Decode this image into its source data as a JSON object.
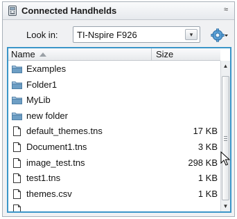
{
  "panel": {
    "title": "Connected Handhelds",
    "collapse_glyph": "≈",
    "icons": {
      "title": "handheld-icon",
      "collapse": "collapse-icon",
      "gear": "gear-icon"
    }
  },
  "lookin": {
    "label": "Look in:",
    "value": "TI-Nspire F926",
    "dropdown_glyph": "▾"
  },
  "filelist": {
    "columns": {
      "name": "Name",
      "size": "Size"
    },
    "sort": "ascending",
    "items": [
      {
        "name": "Examples",
        "size": "",
        "type": "folder"
      },
      {
        "name": "Folder1",
        "size": "",
        "type": "folder"
      },
      {
        "name": "MyLib",
        "size": "",
        "type": "folder"
      },
      {
        "name": "new folder",
        "size": "",
        "type": "folder"
      },
      {
        "name": "default_themes.tns",
        "size": "17 KB",
        "type": "file"
      },
      {
        "name": "Document1.tns",
        "size": "3 KB",
        "type": "file"
      },
      {
        "name": "image_test.tns",
        "size": "298 KB",
        "type": "file"
      },
      {
        "name": "test1.tns",
        "size": "1 KB",
        "type": "file"
      },
      {
        "name": "themes.csv",
        "size": "1 KB",
        "type": "file"
      },
      {
        "name": "",
        "size": "",
        "type": "file"
      }
    ]
  },
  "scrollbar": {
    "up_glyph": "▲",
    "down_glyph": "▼",
    "position_fraction": 0.1
  },
  "colors": {
    "focus_border": "#3a95c8",
    "folder": "#6d9ec4",
    "panel_bg": "#f0f1f3"
  }
}
